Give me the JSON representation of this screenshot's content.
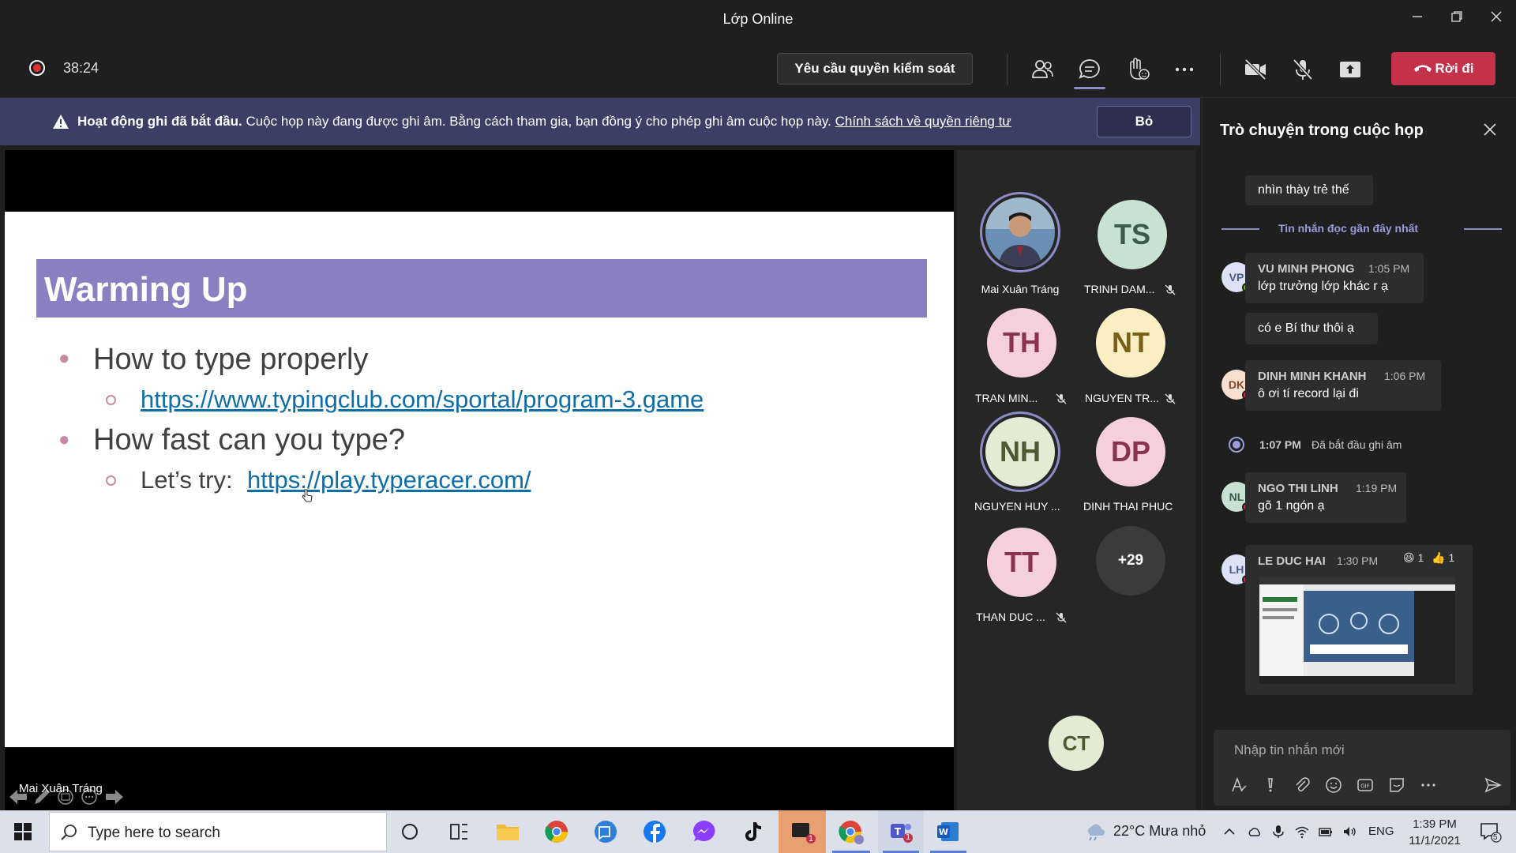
{
  "window": {
    "title": "Lớp Online"
  },
  "toolbar": {
    "timer": "38:24",
    "request_control_label": "Yêu cầu quyền kiểm soát",
    "leave_label": "Rời đi"
  },
  "banner": {
    "bold_text": "Hoạt động ghi đã bắt đầu.",
    "text": "Cuộc họp này đang được ghi âm. Bằng cách tham gia, bạn đồng ý cho phép ghi âm cuộc họp này.",
    "link_text": "Chính sách về quyền riêng tư",
    "dismiss_label": "Bỏ"
  },
  "slide": {
    "title": "Warming Up",
    "items": [
      {
        "text": "How to type properly",
        "sub_prefix": "",
        "sub_link": "https://www.typingclub.com/sportal/program-3.game"
      },
      {
        "text": "How fast can you type?",
        "sub_prefix": "Let’s try:",
        "sub_link": "https://play.typeracer.com/"
      }
    ],
    "presenter": "Mai Xuân Tráng"
  },
  "participants": {
    "tiles": [
      {
        "initials": "",
        "name": "Mai Xuân Tráng",
        "muted": false,
        "photo": true
      },
      {
        "initials": "TS",
        "name": "TRINH DAM...",
        "muted": true,
        "bg": "#c9e1d2",
        "fg": "#3d5b48"
      },
      {
        "initials": "TH",
        "name": "TRAN MIN...",
        "muted": true,
        "bg": "#f5d0dc",
        "fg": "#8a3351"
      },
      {
        "initials": "NT",
        "name": "NGUYEN TR...",
        "muted": true,
        "bg": "#fbeec3",
        "fg": "#7a5f16"
      },
      {
        "initials": "NH",
        "name": "NGUYEN HUY ...",
        "muted": false,
        "bg": "#e3ebd5",
        "fg": "#4b5a31"
      },
      {
        "initials": "DP",
        "name": "DINH THAI PHUC",
        "muted": false,
        "bg": "#f5d0dc",
        "fg": "#8a3351"
      },
      {
        "initials": "TT",
        "name": "THAN DUC ...",
        "muted": true,
        "bg": "#f5d0dc",
        "fg": "#8a3351"
      }
    ],
    "more_label": "+29",
    "self_initials": "CT"
  },
  "chat": {
    "title": "Trò chuyện trong cuộc họp",
    "top_message": "nhìn thày trẻ thế",
    "last_read_label": "Tin nhắn đọc gần đây nhất",
    "messages": [
      {
        "initials": "VP",
        "name": "VU MINH PHONG",
        "time": "1:05 PM",
        "text": "lớp trưởng lớp khác r ạ",
        "extra": "có e Bí thư thôi ạ"
      },
      {
        "initials": "DK",
        "name": "DINH MINH KHANH",
        "time": "1:06 PM",
        "text": "ô ơi tí record lại đi"
      },
      {
        "initials": "NL",
        "name": "NGO THI LINH",
        "time": "1:19 PM",
        "text": "gõ 1 ngón ạ"
      },
      {
        "initials": "LH",
        "name": "LE DUC HAI",
        "time": "1:30 PM",
        "reaction_laugh": "1",
        "reaction_like": "1"
      }
    ],
    "system": {
      "time": "1:07 PM",
      "text": "Đã bắt đầu ghi âm"
    },
    "compose_placeholder": "Nhập tin nhắn mới"
  },
  "taskbar": {
    "search_placeholder": "Type here to search",
    "weather": "22°C  Mưa nhỏ",
    "language": "ENG",
    "time": "1:39 PM",
    "date": "11/1/2021",
    "badge_one": "1",
    "badge_two": "1",
    "notification_count": "5"
  },
  "colors": {
    "accent": "#8b8cc7",
    "leave": "#c4314b",
    "banner": "#3b3f66",
    "slide_title": "#8a7fc1"
  }
}
